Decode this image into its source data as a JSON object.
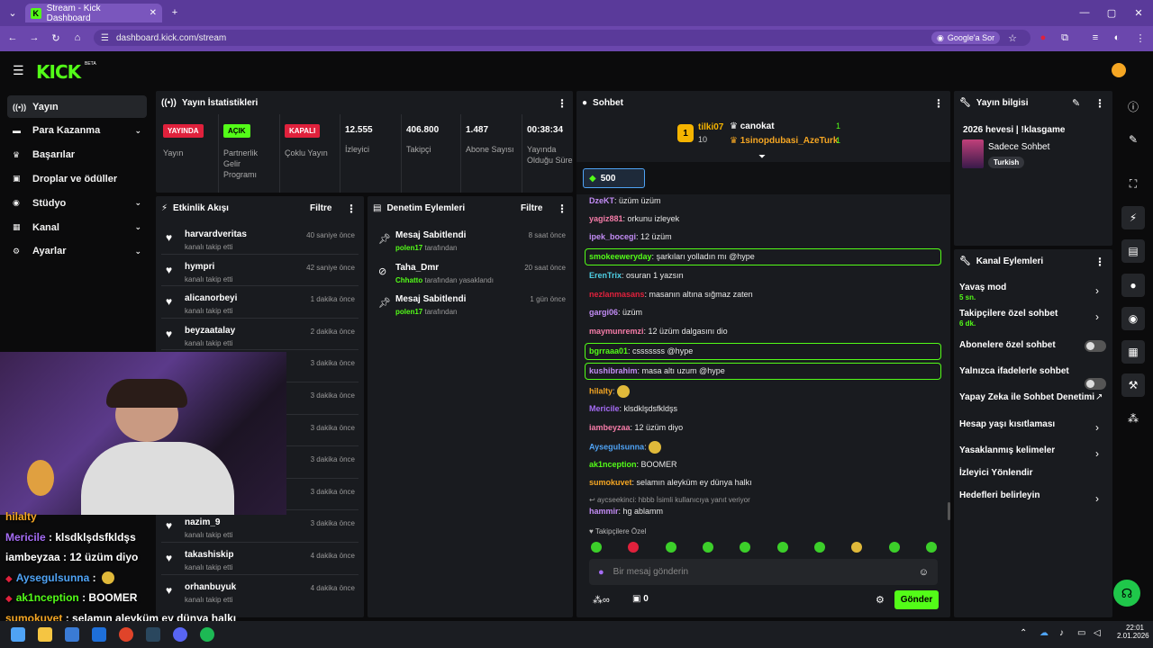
{
  "browser": {
    "tab_title": "Stream - Kick Dashboard",
    "url": "dashboard.kick.com/stream",
    "google_btn": "Google'a Sor"
  },
  "kick": {
    "logo": "KICK",
    "beta": "BETA"
  },
  "nav": [
    {
      "label": "Yayın",
      "icon": "broadcast-icon"
    },
    {
      "label": "Para Kazanma",
      "icon": "money-icon"
    },
    {
      "label": "Başarılar",
      "icon": "trophy-icon"
    },
    {
      "label": "Droplar ve ödüller",
      "icon": "gift-icon"
    },
    {
      "label": "Stüdyo",
      "icon": "studio-icon"
    },
    {
      "label": "Kanal",
      "icon": "channel-icon"
    },
    {
      "label": "Ayarlar",
      "icon": "gear-icon"
    }
  ],
  "stats": {
    "title": "Yayın İstatistikleri",
    "items": [
      {
        "badge": "YAYINDA",
        "badge_color": "#e0213c",
        "label": "Yayın"
      },
      {
        "badge": "AÇIK",
        "badge_color": "#53fc18",
        "label": "Partnerlik Gelir Programı"
      },
      {
        "badge": "KAPALI",
        "badge_color": "#e0213c",
        "label": "Çoklu Yayın"
      },
      {
        "value": "12.555",
        "label": "İzleyici"
      },
      {
        "value": "406.800",
        "label": "Takipçi"
      },
      {
        "value": "1.487",
        "label": "Abone Sayısı"
      },
      {
        "value": "00:38:34",
        "label": "Yayında Olduğu Süre"
      }
    ]
  },
  "activity": {
    "title": "Etkinlik Akışı",
    "filter": "Filtre",
    "items": [
      {
        "name": "harvardveritas",
        "sub": "kanalı takip etti",
        "time": "40 saniye önce"
      },
      {
        "name": "hympri",
        "sub": "kanalı takip etti",
        "time": "42 saniye önce"
      },
      {
        "name": "alicanorbeyi",
        "sub": "kanalı takip etti",
        "time": "1 dakika önce"
      },
      {
        "name": "beyzaatalay",
        "sub": "kanalı takip etti",
        "time": "2 dakika önce"
      },
      {
        "name": "",
        "sub": "",
        "time": "3 dakika önce"
      },
      {
        "name": "",
        "sub": "",
        "time": "3 dakika önce"
      },
      {
        "name": "",
        "sub": "",
        "time": "3 dakika önce"
      },
      {
        "name": "",
        "sub": "",
        "time": "3 dakika önce"
      },
      {
        "name": "",
        "sub": "",
        "time": "3 dakika önce"
      },
      {
        "name": "nazim_9",
        "sub": "kanalı takip etti",
        "time": "3 dakika önce"
      },
      {
        "name": "takashiskip",
        "sub": "kanalı takip etti",
        "time": "4 dakika önce"
      },
      {
        "name": "orhanbuyuk",
        "sub": "kanalı takip etti",
        "time": "4 dakika önce"
      }
    ]
  },
  "moderation": {
    "title": "Denetim Eylemleri",
    "filter": "Filtre",
    "items": [
      {
        "title": "Mesaj Sabitlendi",
        "by": "polen17",
        "suffix": "tarafından",
        "time": "8 saat önce"
      },
      {
        "title": "Taha_Dmr",
        "by": "Chhatto",
        "suffix": "tarafından yasaklandı",
        "time": "20 saat önce"
      },
      {
        "title": "Mesaj Sabitlendi",
        "by": "polen17",
        "suffix": "tarafından",
        "time": "1 gün önce"
      }
    ]
  },
  "chat": {
    "title": "Sohbet",
    "leader1": {
      "name": "tilki07",
      "count": "10",
      "rank": "1"
    },
    "leader2": {
      "name": "canokat",
      "count": "1"
    },
    "leader3": {
      "name": "1sinopdubasi_AzeTurk",
      "count": "1"
    },
    "goal": "500",
    "messages": [
      {
        "user": "DzeKT",
        "color": "#c38cf5",
        "text": "üzüm üzüm"
      },
      {
        "user": "yagiz881",
        "color": "#f57ca8",
        "text": "orkunu izleyek"
      },
      {
        "user": "ipek_bocegi",
        "color": "#c38cf5",
        "text": "12 üzüm"
      },
      {
        "user": "smokeeweryday",
        "color": "#53fc18",
        "text": "şarkıları yolladın mı @hype"
      },
      {
        "user": "ErenTrix",
        "color": "#4fd1e6",
        "text": "osuran 1 yazsın"
      },
      {
        "user": "nezlanmasans",
        "color": "#e0213c",
        "text": "masanın altına sığmaz zaten"
      },
      {
        "user": "gargi06",
        "color": "#c38cf5",
        "text": "üzüm"
      },
      {
        "user": "maymunremzi",
        "color": "#f57ca8",
        "text": "12 üzüm dalgasını dio"
      },
      {
        "user": "bgrraaa01",
        "color": "#53fc18",
        "text": "csssssss @hype"
      },
      {
        "user": "kushibrahim",
        "color": "#c38cf5",
        "text": "masa altı uzum @hype"
      },
      {
        "user": "hilalty",
        "color": "#f5a623",
        "text": ""
      },
      {
        "user": "Mericile",
        "color": "#a56cf5",
        "text": "klsdklşdsfkldşs"
      },
      {
        "user": "iambeyzaa",
        "color": "#f57ca8",
        "text": "12 üzüm diyo"
      },
      {
        "user": "Aysegulsunna",
        "color": "#4fa3f5",
        "text": ""
      },
      {
        "user": "ak1nception",
        "color": "#53fc18",
        "text": "BOOMER"
      },
      {
        "user": "sumokuvet",
        "color": "#f5a623",
        "text": "selamın aleyküm ey dünya halkı"
      }
    ],
    "reply_note": "aycseekinci: hbbb İsimli kullanıcıya yanıt veriyor",
    "last": {
      "user": "hammir",
      "color": "#c38cf5",
      "text": "hg ablamm"
    },
    "followers_only": "Takipçilere Özel",
    "placeholder": "Bir mesaj gönderin",
    "points": "0",
    "send": "Gönder"
  },
  "streaminfo": {
    "title": "Yayın bilgisi",
    "stream_title": "2026 hevesi | !klasgame",
    "category": "Sadece Sohbet",
    "tag": "Turkish"
  },
  "channel_actions": {
    "title": "Kanal Eylemleri",
    "items": [
      {
        "label": "Yavaş mod",
        "sub": "5 sn.",
        "type": "chevron"
      },
      {
        "label": "Takipçilere özel sohbet",
        "sub": "6 dk.",
        "type": "chevron"
      },
      {
        "label": "Abonelere özel sohbet",
        "sub": "",
        "type": "toggle"
      },
      {
        "label": "Yalnızca ifadelerle sohbet",
        "sub": "",
        "type": "toggle"
      },
      {
        "label": "Yapay Zeka ile Sohbet Denetimi",
        "sub": "",
        "type": "external"
      },
      {
        "label": "Hesap yaşı kısıtlaması",
        "sub": "",
        "type": "chevron"
      },
      {
        "label": "Yasaklanmış kelimeler",
        "sub": "",
        "type": "chevron"
      },
      {
        "label": "İzleyici Yönlendir",
        "sub": "",
        "type": "none"
      },
      {
        "label": "Hedefleri belirleyin",
        "sub": "",
        "type": "chevron"
      }
    ]
  },
  "overlay": [
    {
      "user": "hilalty",
      "color": "#f5a623",
      "text": ""
    },
    {
      "user": "Mericile",
      "color": "#a56cf5",
      "text": ": klsdklşdsfkldşs"
    },
    {
      "user": "iambeyzaa",
      "color": "#fff",
      "text": ": 12 üzüm diyo"
    },
    {
      "user": "Aysegulsunna",
      "color": "#4fa3f5",
      "text": ":"
    },
    {
      "user": "ak1nception",
      "color": "#53fc18",
      "text": ": BOOMER"
    },
    {
      "user": "sumokuvet",
      "color": "#f5a623",
      "text": ": selamın aleyküm ey dünya halkı"
    }
  ],
  "taskbar": {
    "time": "22:01",
    "date": "2.01.2026"
  }
}
